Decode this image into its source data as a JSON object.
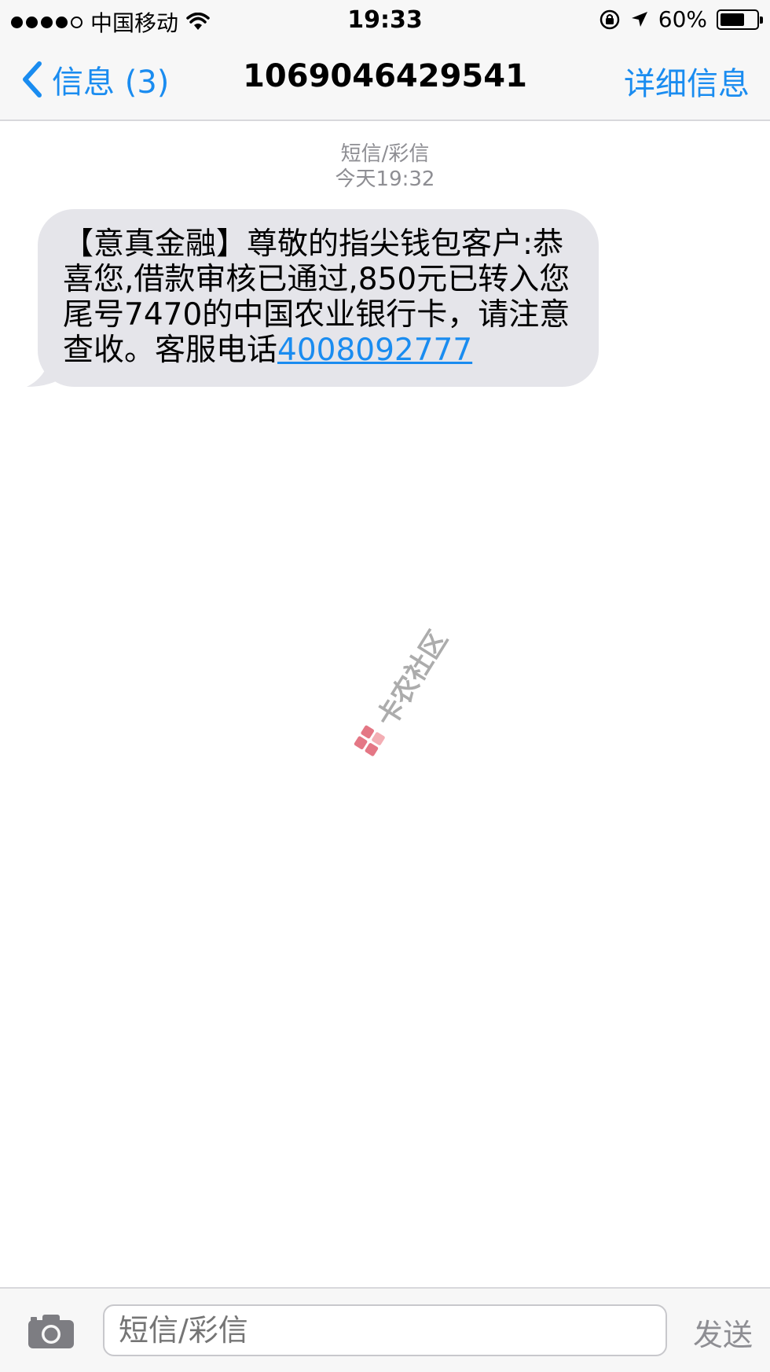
{
  "status_bar": {
    "carrier": "中国移动",
    "time": "19:33",
    "battery_percent": "60%",
    "battery_level": 0.6
  },
  "nav": {
    "back_label": "信息 (3)",
    "title": "1069046429541",
    "detail_label": "详细信息"
  },
  "thread_meta": {
    "type": "短信/彩信",
    "timestamp": "今天19:32"
  },
  "message": {
    "lines": [
      "【意真金融】尊敬的指尖钱包客户:恭",
      "喜您,借款审核已通过,850元已转入您",
      "尾号7470的中国农业银行卡，请注意"
    ],
    "last_line_prefix": "查收。客服电话",
    "phone": "4008092777"
  },
  "watermark": {
    "text": "卡农社区"
  },
  "composer": {
    "placeholder": "短信/彩信",
    "send_label": "发送"
  },
  "colors": {
    "accent": "#1a8cf0",
    "bubble": "#e5e5ea",
    "meta_text": "#8e8e93",
    "bar_bg": "#f7f7f7"
  }
}
